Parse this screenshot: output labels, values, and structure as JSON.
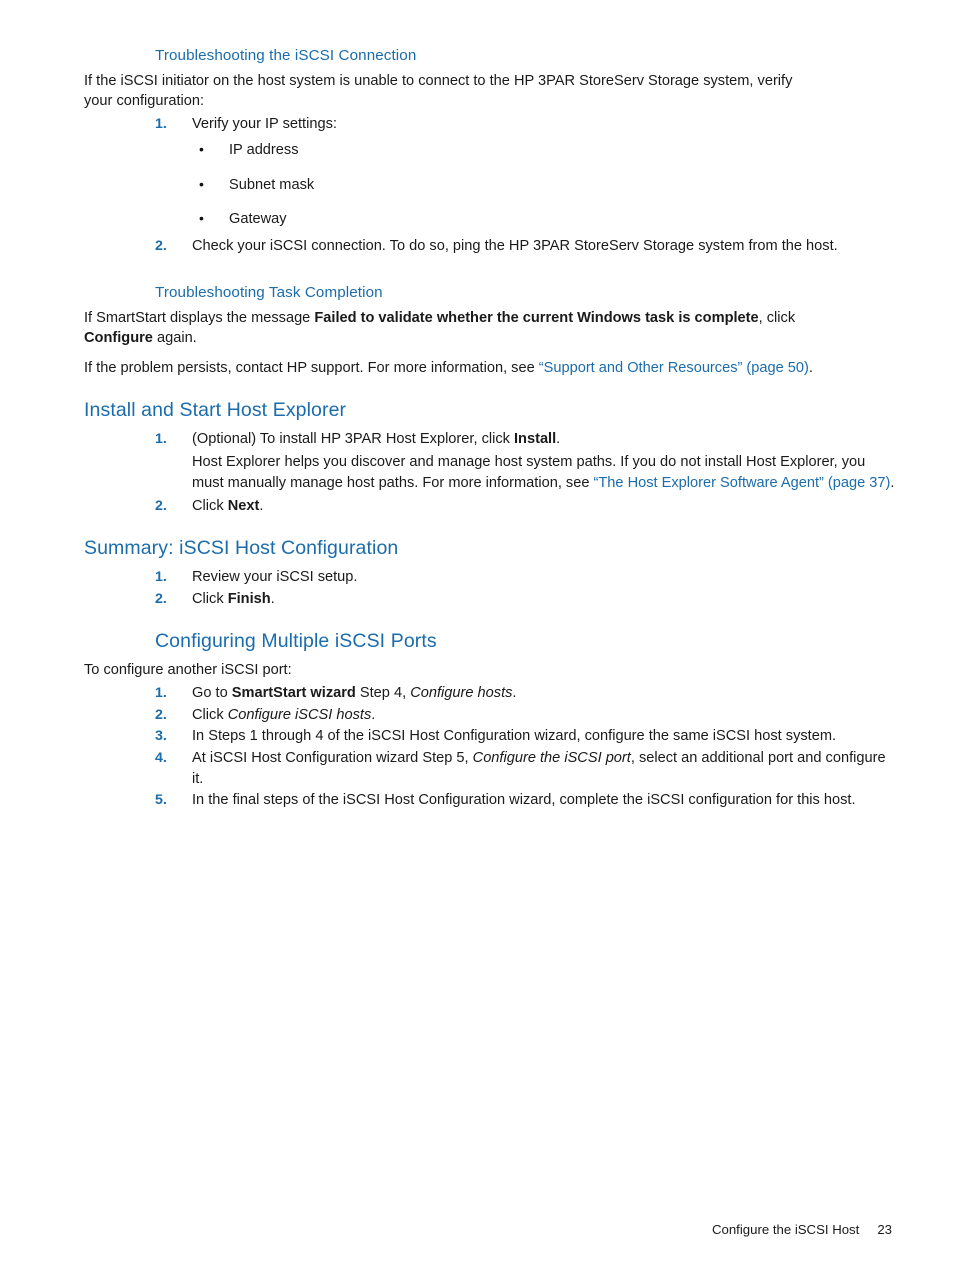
{
  "document": {
    "footer_section": "Configure the iSCSI Host",
    "footer_page": "23",
    "heading_color": "#1b6cab",
    "link_color": "#1b6cab",
    "text_color": "#1a1a1a"
  },
  "sections": {
    "troubleshooting_connection": {
      "heading": "Troubleshooting the iSCSI Connection",
      "intro": "If the iSCSI initiator on the host system is unable to connect to the HP 3PAR StoreServ Storage system, verify your configuration:",
      "step1": {
        "num": "1.",
        "text": "Verify your IP settings:",
        "bullets": [
          {
            "marker": "•",
            "text": "IP address"
          },
          {
            "marker": "•",
            "text": "Subnet mask"
          },
          {
            "marker": "•",
            "text": "Gateway"
          }
        ]
      },
      "step2": {
        "num": "2.",
        "text": "Check your iSCSI connection. To do so, ping the HP 3PAR StoreServ Storage system from the host."
      }
    },
    "troubleshooting_task": {
      "heading": "Troubleshooting Task Completion",
      "para1_a": "If SmartStart displays the message ",
      "para1_bold1": "Failed to validate whether the current Windows task is complete",
      "para1_b": ", click ",
      "para1_bold2": "Configure",
      "para1_c": " again.",
      "para2_a": "If the problem persists, contact HP support. For more information, see ",
      "para2_link": "“Support and Other Resources” (page 50)",
      "para2_b": "."
    },
    "install_host_explorer": {
      "heading": "Install and Start Host Explorer",
      "step1": {
        "num": "1.",
        "text_a": "(Optional) To install HP 3PAR Host Explorer, click ",
        "bold": "Install",
        "text_b": ".",
        "sub_a": "Host Explorer helps you discover and manage host system paths. If you do not install Host Explorer, you must manually manage host paths. For more information, see ",
        "sub_link": "“The Host Explorer Software Agent” (page 37)",
        "sub_b": "."
      },
      "step2": {
        "num": "2.",
        "text_a": "Click ",
        "bold": "Next",
        "text_b": "."
      }
    },
    "summary": {
      "heading": "Summary: iSCSI Host Configuration",
      "step1": {
        "num": "1.",
        "text": "Review your iSCSI setup."
      },
      "step2": {
        "num": "2.",
        "text_a": "Click ",
        "bold": "Finish",
        "text_b": "."
      }
    },
    "configuring_multiple_ports": {
      "heading": "Configuring Multiple iSCSI Ports",
      "intro": "To configure another iSCSI port:",
      "steps": [
        {
          "num": "1.",
          "text_a": "Go to ",
          "bold": "SmartStart wizard",
          "text_b": " Step 4, ",
          "italic": "Configure hosts",
          "text_c": "."
        },
        {
          "num": "2.",
          "text_a": "Click ",
          "italic": "Configure iSCSI hosts",
          "text_b": "."
        },
        {
          "num": "3.",
          "text_a": "In Steps 1 through 4 of the iSCSI Host Configuration wizard, configure the same iSCSI host system.",
          "italic": "",
          "text_b": "",
          "text_c": ""
        },
        {
          "num": "4.",
          "text_a": "At iSCSI Host Configuration wizard Step 5, ",
          "italic": "Configure the iSCSI port",
          "text_b": ", select an additional port and configure it.",
          "text_c": ""
        },
        {
          "num": "5.",
          "text_a": "In the final steps of the iSCSI Host Configuration wizard, complete the iSCSI configuration for this host.",
          "italic": "",
          "text_b": "",
          "text_c": ""
        }
      ]
    }
  }
}
